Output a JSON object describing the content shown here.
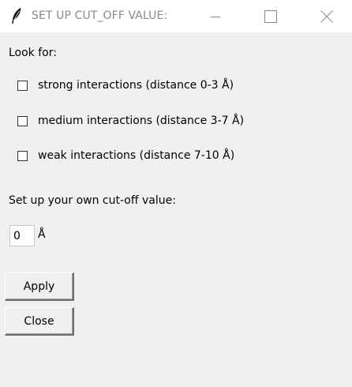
{
  "window": {
    "title": "SET UP CUT_OFF VALUE:",
    "icon": "feather-icon",
    "controls": [
      "minimize-icon",
      "maximize-icon",
      "close-icon"
    ]
  },
  "look_for": {
    "label": "Look for:",
    "options": [
      {
        "label": "strong interactions (distance 0-3 Å)",
        "checked": false
      },
      {
        "label": "medium interactions (distance 3-7 Å)",
        "checked": false
      },
      {
        "label": "weak interactions (distance 7-10 Å)",
        "checked": false
      }
    ]
  },
  "cutoff": {
    "label": "Set up your own cut-off value:",
    "value": "0",
    "unit": "Å"
  },
  "buttons": {
    "apply": "Apply",
    "close": "Close"
  },
  "colors": {
    "background": "#f0f0f0",
    "titlebar": "#ffffff",
    "title_text": "#8a8a8a"
  }
}
